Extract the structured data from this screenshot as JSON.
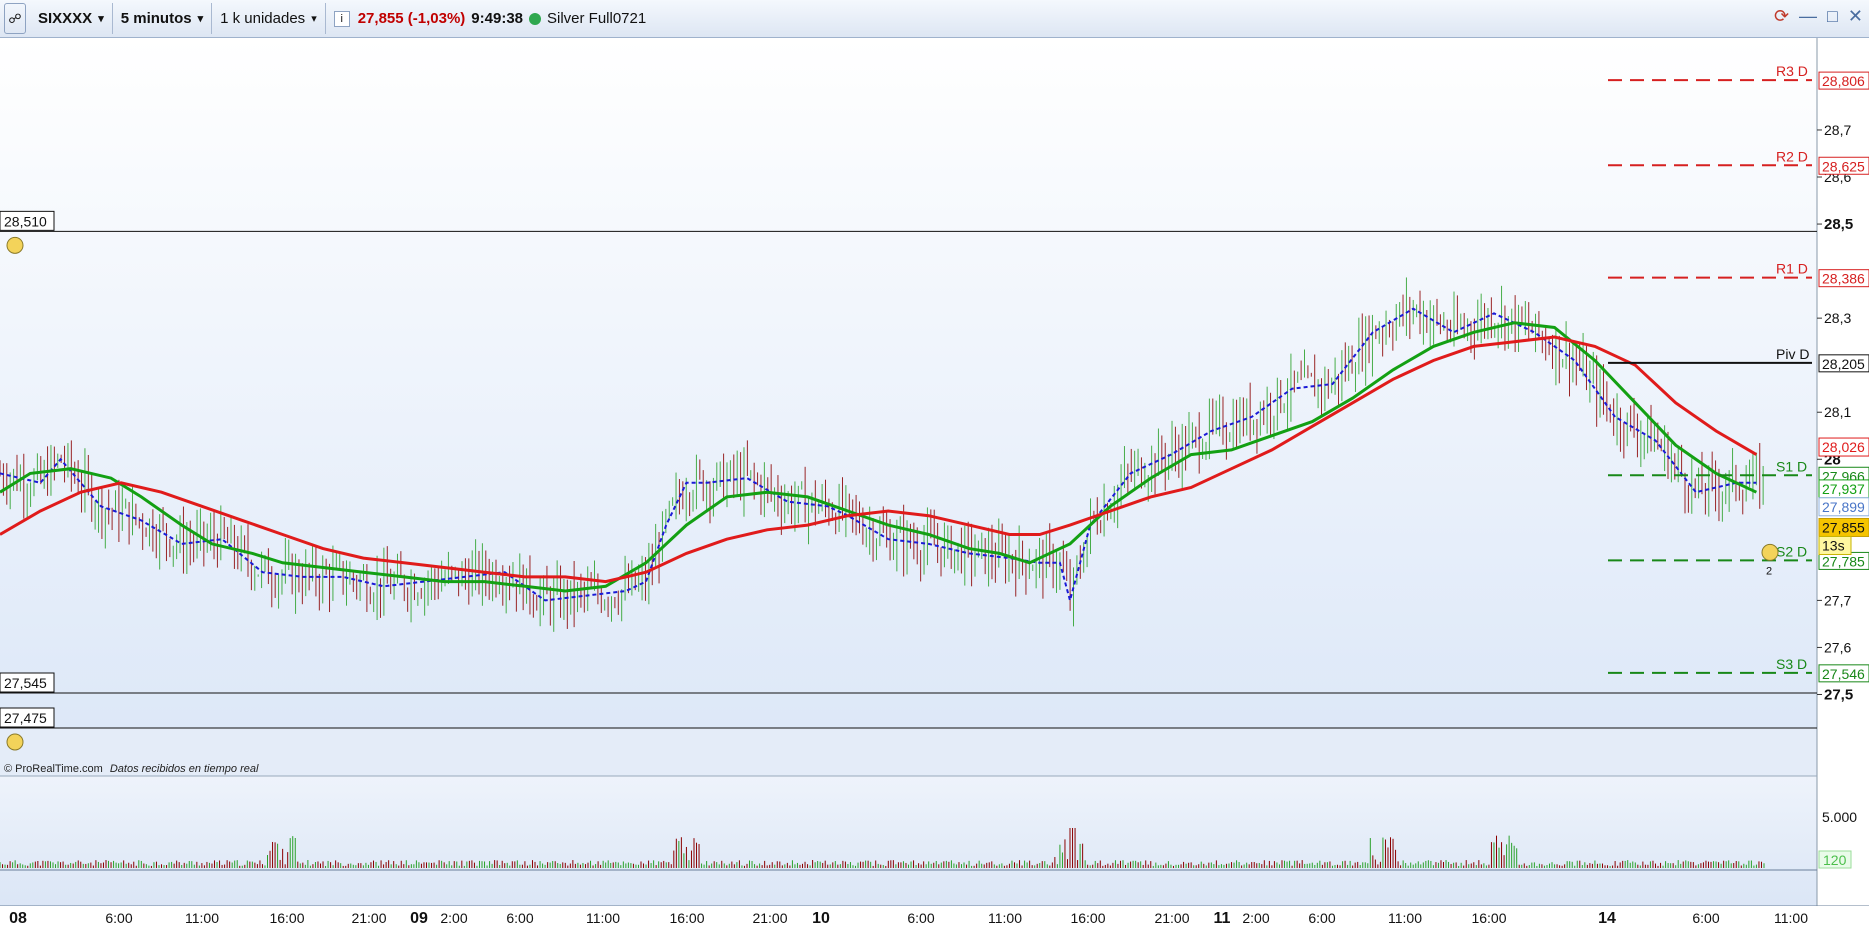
{
  "toolbar": {
    "chain_icon": "chain-link-icon",
    "symbol": "SIXXXX",
    "timeframe": "5 minutos",
    "units": "1 k unidades",
    "info_icon": "i",
    "price_change": "27,855 (-1,03%)",
    "time": "9:49:38",
    "instrument": "Silver Full0721",
    "window_icons": [
      "refresh-icon",
      "minimize-icon",
      "maximize-icon",
      "close-icon"
    ]
  },
  "credit": "© ProRealTime.com",
  "credit_note": "Datos recibidos en tiempo real",
  "colors": {
    "candle_up": "#2aa12a",
    "candle_down": "#8b0000",
    "sma_red": "#e01b1b",
    "sma_green": "#13a013",
    "dashed_blue": "#1a1ad6",
    "pivot_red": "#d62020",
    "pivot_green": "#188818"
  },
  "chart_data": {
    "type": "line",
    "ylim": [
      27.45,
      28.87
    ],
    "y_ticks": [
      "28,7",
      "28,6",
      "28,5",
      "28,3",
      "28,1",
      "28",
      "27,7",
      "27,6",
      "27,5"
    ],
    "x_ticks": [
      "08",
      "6:00",
      "11:00",
      "16:00",
      "21:00",
      "09",
      "2:00",
      "6:00",
      "11:00",
      "16:00",
      "21:00",
      "10",
      "6:00",
      "11:00",
      "16:00",
      "21:00",
      "11",
      "2:00",
      "6:00",
      "11:00",
      "16:00",
      "14",
      "6:00",
      "11:00"
    ],
    "pivot_levels": [
      {
        "label": "R3 D",
        "value": 28.806,
        "text": "28,806"
      },
      {
        "label": "R2 D",
        "value": 28.625,
        "text": "28,625"
      },
      {
        "label": "R1 D",
        "value": 28.386,
        "text": "28,386"
      },
      {
        "label": "Piv D",
        "value": 28.205,
        "text": "28,205"
      },
      {
        "label": "S1 D",
        "value": 27.966,
        "text": "27,966"
      },
      {
        "label": "S2 D",
        "value": 27.785,
        "text": "27,785"
      },
      {
        "label": "S3 D",
        "value": 27.546,
        "text": "27,546"
      }
    ],
    "price_tags": [
      {
        "value": 28.026,
        "text": "28,026"
      },
      {
        "value": 27.937,
        "text": "27,937"
      },
      {
        "value": 27.899,
        "text": "27,899"
      },
      {
        "value": 27.855,
        "text": "27,855"
      }
    ],
    "alert_levels": [
      {
        "value": 28.51,
        "text": "28,510"
      },
      {
        "value": 27.545,
        "text": "27,545"
      },
      {
        "value": 27.475,
        "text": "27,475"
      }
    ],
    "countdown": "13s",
    "alert_count": "2",
    "series": [
      {
        "values": [
          [
            0,
            27.93
          ],
          [
            3,
            27.97
          ],
          [
            7,
            27.98
          ],
          [
            11,
            27.96
          ],
          [
            14,
            27.92
          ],
          [
            18,
            27.86
          ],
          [
            21,
            27.82
          ],
          [
            25,
            27.8
          ],
          [
            28,
            27.78
          ],
          [
            32,
            27.77
          ],
          [
            36,
            27.76
          ],
          [
            40,
            27.75
          ],
          [
            44,
            27.74
          ],
          [
            48,
            27.74
          ],
          [
            52,
            27.73
          ],
          [
            56,
            27.72
          ],
          [
            60,
            27.73
          ],
          [
            64,
            27.78
          ],
          [
            68,
            27.86
          ],
          [
            72,
            27.92
          ],
          [
            76,
            27.93
          ],
          [
            80,
            27.92
          ],
          [
            84,
            27.89
          ],
          [
            88,
            27.86
          ],
          [
            92,
            27.84
          ],
          [
            96,
            27.81
          ],
          [
            99,
            27.8
          ],
          [
            102,
            27.78
          ],
          [
            106,
            27.82
          ],
          [
            110,
            27.9
          ],
          [
            114,
            27.96
          ],
          [
            118,
            28.01
          ],
          [
            122,
            28.02
          ],
          [
            126,
            28.05
          ],
          [
            130,
            28.08
          ],
          [
            134,
            28.13
          ],
          [
            138,
            28.19
          ],
          [
            142,
            28.24
          ],
          [
            146,
            28.27
          ],
          [
            150,
            28.29
          ],
          [
            154,
            28.28
          ],
          [
            158,
            28.21
          ],
          [
            162,
            28.12
          ],
          [
            166,
            28.03
          ],
          [
            170,
            27.97
          ],
          [
            174,
            27.93
          ]
        ]
      },
      {
        "values": [
          [
            0,
            27.84
          ],
          [
            4,
            27.89
          ],
          [
            8,
            27.93
          ],
          [
            12,
            27.95
          ],
          [
            16,
            27.93
          ],
          [
            20,
            27.9
          ],
          [
            24,
            27.87
          ],
          [
            28,
            27.84
          ],
          [
            32,
            27.81
          ],
          [
            36,
            27.79
          ],
          [
            40,
            27.78
          ],
          [
            44,
            27.77
          ],
          [
            48,
            27.76
          ],
          [
            52,
            27.75
          ],
          [
            56,
            27.75
          ],
          [
            60,
            27.74
          ],
          [
            64,
            27.76
          ],
          [
            68,
            27.8
          ],
          [
            72,
            27.83
          ],
          [
            76,
            27.85
          ],
          [
            80,
            27.86
          ],
          [
            84,
            27.88
          ],
          [
            88,
            27.89
          ],
          [
            92,
            27.88
          ],
          [
            96,
            27.86
          ],
          [
            100,
            27.84
          ],
          [
            103,
            27.84
          ],
          [
            106,
            27.86
          ],
          [
            110,
            27.89
          ],
          [
            114,
            27.92
          ],
          [
            118,
            27.94
          ],
          [
            122,
            27.98
          ],
          [
            126,
            28.02
          ],
          [
            130,
            28.07
          ],
          [
            134,
            28.12
          ],
          [
            138,
            28.17
          ],
          [
            142,
            28.21
          ],
          [
            146,
            28.24
          ],
          [
            150,
            28.25
          ],
          [
            154,
            28.26
          ],
          [
            158,
            28.24
          ],
          [
            162,
            28.2
          ],
          [
            166,
            28.12
          ],
          [
            170,
            28.06
          ],
          [
            174,
            28.01
          ]
        ]
      },
      {
        "values": [
          [
            0,
            27.97
          ],
          [
            4,
            27.95
          ],
          [
            6,
            28.0
          ],
          [
            10,
            27.9
          ],
          [
            14,
            27.87
          ],
          [
            18,
            27.82
          ],
          [
            22,
            27.83
          ],
          [
            26,
            27.76
          ],
          [
            30,
            27.75
          ],
          [
            34,
            27.75
          ],
          [
            38,
            27.73
          ],
          [
            42,
            27.74
          ],
          [
            46,
            27.75
          ],
          [
            50,
            27.76
          ],
          [
            54,
            27.7
          ],
          [
            58,
            27.71
          ],
          [
            62,
            27.72
          ],
          [
            64,
            27.74
          ],
          [
            66,
            27.86
          ],
          [
            68,
            27.95
          ],
          [
            70,
            27.95
          ],
          [
            74,
            27.96
          ],
          [
            78,
            27.91
          ],
          [
            82,
            27.9
          ],
          [
            84,
            27.88
          ],
          [
            88,
            27.83
          ],
          [
            92,
            27.82
          ],
          [
            96,
            27.8
          ],
          [
            100,
            27.79
          ],
          [
            103,
            27.78
          ],
          [
            105,
            27.78
          ],
          [
            106,
            27.7
          ],
          [
            108,
            27.86
          ],
          [
            112,
            27.97
          ],
          [
            116,
            28.01
          ],
          [
            120,
            28.06
          ],
          [
            124,
            28.09
          ],
          [
            128,
            28.15
          ],
          [
            132,
            28.16
          ],
          [
            136,
            28.27
          ],
          [
            140,
            28.32
          ],
          [
            144,
            28.27
          ],
          [
            148,
            28.31
          ],
          [
            152,
            28.27
          ],
          [
            156,
            28.21
          ],
          [
            160,
            28.09
          ],
          [
            164,
            28.04
          ],
          [
            168,
            27.93
          ],
          [
            172,
            27.95
          ],
          [
            174,
            27.95
          ]
        ]
      }
    ],
    "ohlc_sample_count": 520,
    "volume_label": "5.000",
    "volume_value": "120"
  }
}
